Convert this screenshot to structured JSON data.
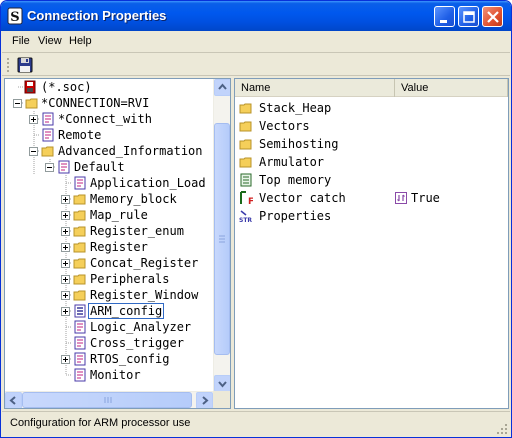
{
  "window": {
    "title": "Connection Properties"
  },
  "menu": {
    "items": [
      "File",
      "View",
      "Help"
    ]
  },
  "toolbar": {
    "save_icon": "floppy-disk-icon"
  },
  "tree": {
    "items": [
      {
        "label": "(*.soc)",
        "icon": "soc-file-icon"
      },
      {
        "label": "*CONNECTION=RVI",
        "icon": "folder-icon"
      },
      {
        "label": "*Connect_with",
        "icon": "property-group-icon"
      },
      {
        "label": "Remote",
        "icon": "property-group-icon"
      },
      {
        "label": "Advanced_Information",
        "icon": "folder-icon"
      },
      {
        "label": "Default",
        "icon": "property-group-icon"
      },
      {
        "label": "Application_Load",
        "icon": "property-group-icon"
      },
      {
        "label": "Memory_block",
        "icon": "folder-icon"
      },
      {
        "label": "Map_rule",
        "icon": "folder-icon"
      },
      {
        "label": "Register_enum",
        "icon": "folder-icon"
      },
      {
        "label": "Register",
        "icon": "folder-icon"
      },
      {
        "label": "Concat_Register",
        "icon": "folder-icon"
      },
      {
        "label": "Peripherals",
        "icon": "folder-icon"
      },
      {
        "label": "Register_Window",
        "icon": "folder-icon"
      },
      {
        "label": "ARM_config",
        "icon": "config-icon"
      },
      {
        "label": "Logic_Analyzer",
        "icon": "property-group-icon"
      },
      {
        "label": "Cross_trigger",
        "icon": "property-group-icon"
      },
      {
        "label": "RTOS_config",
        "icon": "property-group-icon"
      },
      {
        "label": "Monitor",
        "icon": "property-group-icon"
      }
    ]
  },
  "list": {
    "columns": [
      "Name",
      "Value"
    ],
    "rows": [
      {
        "name": "Stack_Heap",
        "value": "",
        "icon": "folder-icon"
      },
      {
        "name": "Vectors",
        "value": "",
        "icon": "folder-icon"
      },
      {
        "name": "Semihosting",
        "value": "",
        "icon": "folder-icon"
      },
      {
        "name": "Armulator",
        "value": "",
        "icon": "folder-icon"
      },
      {
        "name": "Top memory",
        "value": "",
        "icon": "numeric-field-icon"
      },
      {
        "name": "Vector catch",
        "value": "True",
        "icon": "flag-icon"
      },
      {
        "name": "Properties",
        "value": "",
        "icon": "string-property-icon"
      }
    ]
  },
  "status": {
    "text": "Configuration for ARM processor use"
  },
  "colors": {
    "title_bar": "#0058ee",
    "selection_border": "#316ac5",
    "folder": "#f5cf5a"
  }
}
